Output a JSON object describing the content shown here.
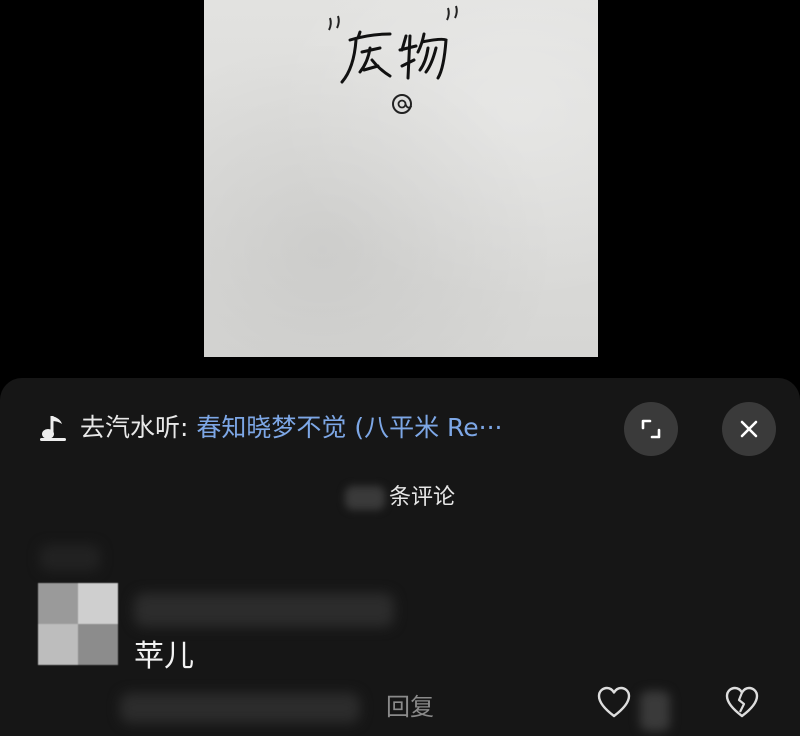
{
  "post": {
    "note_text": "“废物”",
    "note_mark": "@"
  },
  "music": {
    "icon": "music-note-icon",
    "prefix": "去汽水听: ",
    "song": "春知晓梦不觉 (八平米 Re···",
    "song_color": "#7da7e6"
  },
  "actions": {
    "expand_icon": "expand-icon",
    "close_icon": "close-icon"
  },
  "comments_header": {
    "label": "条评论"
  },
  "comment": {
    "text": "苹儿",
    "reply_label": "回复",
    "like_icon": "heart-icon",
    "dislike_icon": "broken-heart-icon"
  }
}
